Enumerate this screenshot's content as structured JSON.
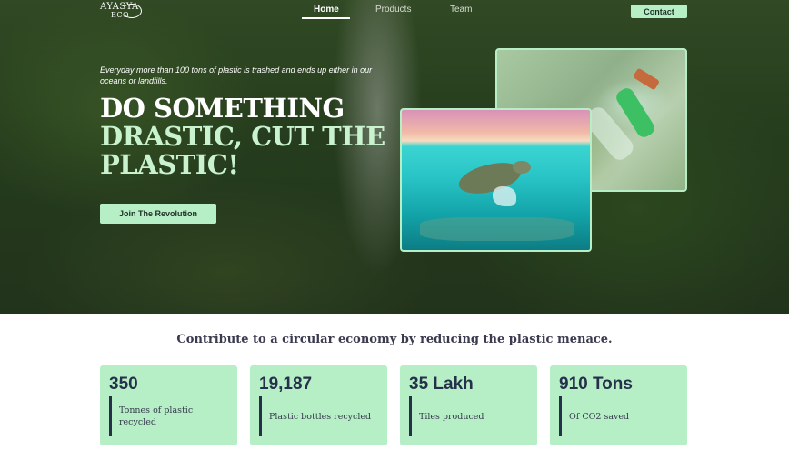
{
  "logo": {
    "line1": "AYASYA",
    "line2": "ECO"
  },
  "nav": {
    "items": [
      {
        "label": "Home",
        "active": true
      },
      {
        "label": "Products",
        "active": false
      },
      {
        "label": "Team",
        "active": false
      }
    ],
    "contact_label": "Contact"
  },
  "hero": {
    "tagline": "Everyday more than 100 tons of plastic is trashed and ends up either in our oceans or landfills.",
    "headline_line1": "DO SOMETHING",
    "headline_line2": "DRASTIC, CUT THE",
    "headline_line3": "PLASTIC!",
    "cta_label": "Join The Revolution"
  },
  "stats": {
    "title": "Contribute to a circular economy by reducing the plastic menace.",
    "cards": [
      {
        "value": "350",
        "label": "Tonnes of plastic recycled"
      },
      {
        "value": "19,187",
        "label": "Plastic bottles recycled"
      },
      {
        "value": "35 Lakh",
        "label": "Tiles produced"
      },
      {
        "value": "910 Tons",
        "label": "Of CO2 saved"
      }
    ]
  },
  "colors": {
    "accent": "#b6efc6",
    "headline_accent": "#c9f3cf",
    "dark_text": "#25304a"
  }
}
